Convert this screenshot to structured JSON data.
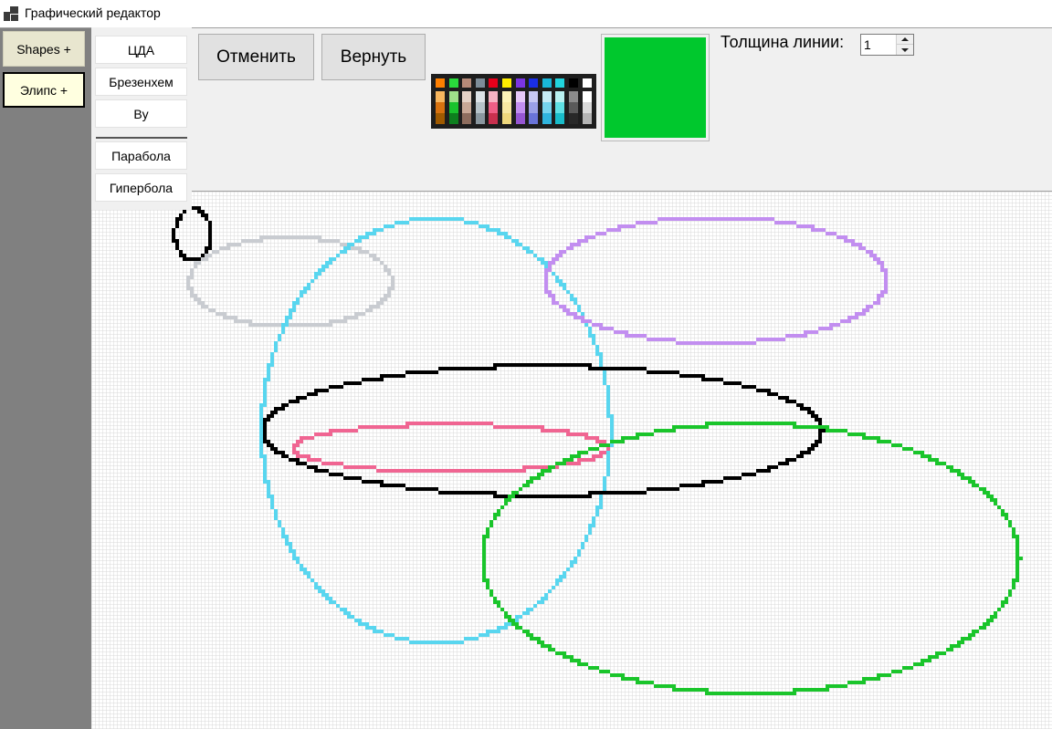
{
  "window": {
    "title": "Графический редактор",
    "app_icon": "app-window-icon"
  },
  "sidebar": {
    "shapes_label": "Shapes +",
    "ellipse_label": "Элипс  +"
  },
  "line_algorithms": [
    "ЦДА",
    "Брезенхем",
    "Ву"
  ],
  "curve_algorithms": [
    "Парабола",
    "Гипербола"
  ],
  "toolbar": {
    "undo_label": "Отменить",
    "redo_label": "Вернуть",
    "thickness_label": "Толщина линии:",
    "thickness_value": "1"
  },
  "current_color": "#00c82d",
  "palette": {
    "top_row": [
      "#ff7f00",
      "#2adb3c",
      "#b78b79",
      "#7d8d99",
      "#e8001b",
      "#ffee00",
      "#7b35e2",
      "#1a2ee6",
      "#19b6d8",
      "#21d4dd",
      "#000000",
      "#ffffff"
    ],
    "columns": [
      [
        "#f7b65e",
        "#d8720f",
        "#a05a00"
      ],
      [
        "#9fe18a",
        "#19c32d",
        "#0d7f1e"
      ],
      [
        "#e6d2c6",
        "#c9a896",
        "#8e6d5e"
      ],
      [
        "#dde3e7",
        "#b7c3c9",
        "#8a979f"
      ],
      [
        "#f7b4c3",
        "#ef5f86",
        "#c8304e"
      ],
      [
        "#fdf4b8",
        "#f7e8a2",
        "#efd87d"
      ],
      [
        "#e6c8f9",
        "#c28ef0",
        "#9656d2"
      ],
      [
        "#c7c8f2",
        "#9ba0e6",
        "#6a74d8"
      ],
      [
        "#c6ecf7",
        "#76d4ee",
        "#30b4dd"
      ],
      [
        "#b9f1f1",
        "#5fe0e4",
        "#19bcc9"
      ],
      [
        "#8c8c8c",
        "#5a5a5a",
        "#282828"
      ],
      [
        "#ffffff",
        "#dadada",
        "#b5b5b5"
      ]
    ]
  },
  "canvas": {
    "grid_color": "#d9d9d9",
    "shapes": [
      {
        "kind": "ellipse",
        "color": "#000000"
      },
      {
        "kind": "ellipse",
        "color": "#c9ccd1"
      },
      {
        "kind": "ellipse",
        "color": "#59d6ef"
      },
      {
        "kind": "ellipse",
        "color": "#c28ef0"
      },
      {
        "kind": "ellipse",
        "color": "#000000"
      },
      {
        "kind": "ellipse",
        "color": "#f06592"
      },
      {
        "kind": "ellipse",
        "color": "#1ac52b"
      }
    ]
  }
}
